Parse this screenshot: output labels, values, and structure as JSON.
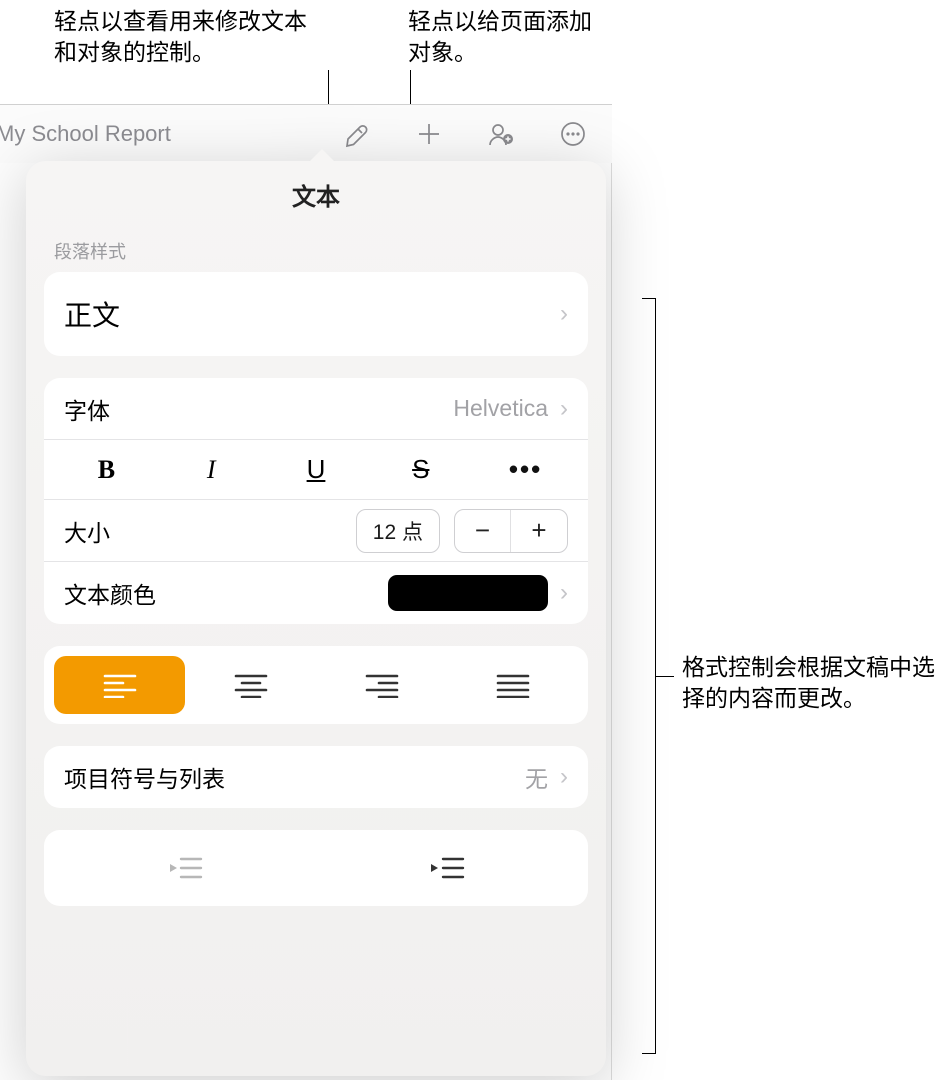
{
  "callouts": {
    "c1": "轻点以查看用来修改文本和对象的控制。",
    "c2": "轻点以给页面添加对象。",
    "c3": "格式控制会根据文稿中选择的内容而更改。"
  },
  "toolbar": {
    "doc_title": "My School Report"
  },
  "popover": {
    "title": "文本",
    "paragraph_style_label": "段落样式",
    "paragraph_style_value": "正文",
    "font_label": "字体",
    "font_value": "Helvetica",
    "style_buttons": {
      "bold": "B",
      "italic": "I",
      "underline": "U",
      "strike": "S",
      "more": "•••"
    },
    "size_label": "大小",
    "size_value": "12 点",
    "stepper_minus": "−",
    "stepper_plus": "+",
    "text_color_label": "文本颜色",
    "text_color_value": "#000000",
    "alignments": [
      "left",
      "center",
      "right",
      "justify"
    ],
    "alignment_active": "left",
    "bullets_label": "项目符号与列表",
    "bullets_value": "无"
  }
}
